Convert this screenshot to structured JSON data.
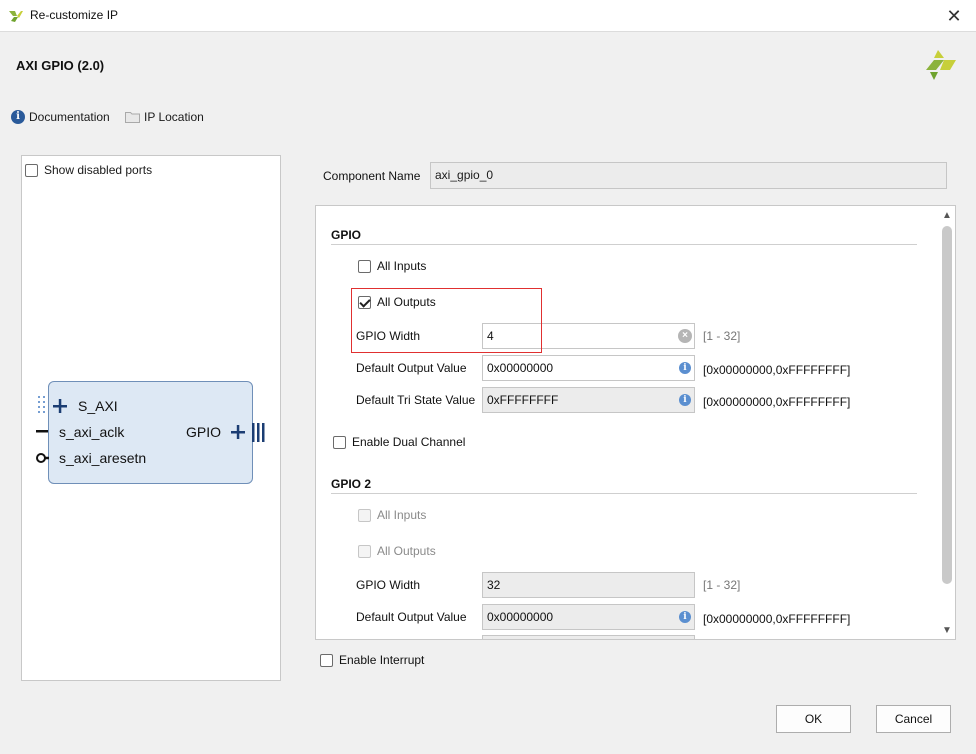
{
  "window": {
    "title": "Re-customize IP",
    "close_glyph": "✕"
  },
  "header": {
    "ip_name": "AXI GPIO (2.0)",
    "doc_label": "Documentation",
    "location_label": "IP Location"
  },
  "left": {
    "show_disabled_label": "Show disabled ports",
    "block": {
      "s_axi": "S_AXI",
      "aclk": "s_axi_aclk",
      "aresetn": "s_axi_aresetn",
      "gpio": "GPIO"
    }
  },
  "component": {
    "label": "Component Name",
    "value": "axi_gpio_0"
  },
  "gpio": {
    "section": "GPIO",
    "all_inputs": {
      "label": "All Inputs",
      "checked": false
    },
    "all_outputs": {
      "label": "All Outputs",
      "checked": true
    },
    "width": {
      "label": "GPIO Width",
      "value": "4",
      "range": "[1 - 32]"
    },
    "default_output": {
      "label": "Default Output Value",
      "value": "0x00000000",
      "range": "[0x00000000,0xFFFFFFFF]"
    },
    "default_tri": {
      "label": "Default Tri State Value",
      "value": "0xFFFFFFFF",
      "range": "[0x00000000,0xFFFFFFFF]"
    }
  },
  "dual_channel": {
    "label": "Enable Dual Channel",
    "checked": false
  },
  "gpio2": {
    "section": "GPIO 2",
    "all_inputs": {
      "label": "All Inputs"
    },
    "all_outputs": {
      "label": "All Outputs"
    },
    "width": {
      "label": "GPIO Width",
      "value": "32",
      "range": "[1 - 32]"
    },
    "default_output": {
      "label": "Default Output Value",
      "value": "0x00000000",
      "range": "[0x00000000,0xFFFFFFFF]"
    }
  },
  "footer": {
    "interrupt_label": "Enable Interrupt",
    "ok": "OK",
    "cancel": "Cancel"
  },
  "colors": {
    "accent_red": "#e03030",
    "block_fill": "#dde8f4",
    "brand": "#8cb33c"
  }
}
